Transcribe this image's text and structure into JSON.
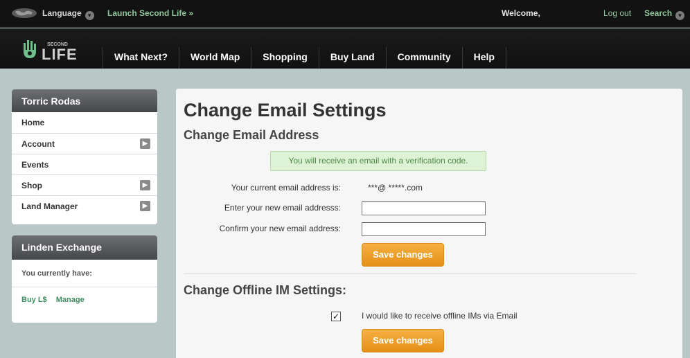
{
  "topbar": {
    "language_label": "Language",
    "launch_label": "Launch Second Life »",
    "welcome_label": "Welcome,",
    "logout_label": "Log out",
    "search_label": "Search"
  },
  "logo": {
    "text_top": "SECOND",
    "text_main": "LIFE"
  },
  "nav": {
    "items": [
      "What Next?",
      "World Map",
      "Shopping",
      "Buy Land",
      "Community",
      "Help"
    ]
  },
  "sidebar": {
    "user_name": "Torric Rodas",
    "menu": [
      "Home",
      "Account",
      "Events",
      "Shop",
      "Land Manager"
    ],
    "exchange": {
      "title": "Linden Exchange",
      "balance_label": "You currently have:",
      "buy_link": "Buy L$",
      "manage_link": "Manage"
    }
  },
  "main": {
    "title": "Change Email Settings",
    "email_section_title": "Change Email Address",
    "notice": "You will receive an email with a verification code.",
    "current_email_label": "Your current email address is:",
    "current_email_value": "***@  *****.com",
    "new_email_label": "Enter your new email addresss:",
    "new_email_value": "",
    "confirm_email_label": "Confirm your new email address:",
    "confirm_email_value": "",
    "save_label": "Save changes",
    "offline_section_title": "Change Offline IM Settings:",
    "offline_checkbox_label": "I would like to receive offline IMs via Email",
    "offline_checked": true,
    "save_label_2": "Save changes"
  },
  "icons": {
    "globe": "globe-icon",
    "chevron": "chevron-down-icon",
    "arrow": "chevron-right-icon",
    "check": "checkmark-icon"
  },
  "colors": {
    "accent_green": "#8fc79c",
    "button_orange": "#f0a030",
    "notice_bg": "#def2d6"
  }
}
